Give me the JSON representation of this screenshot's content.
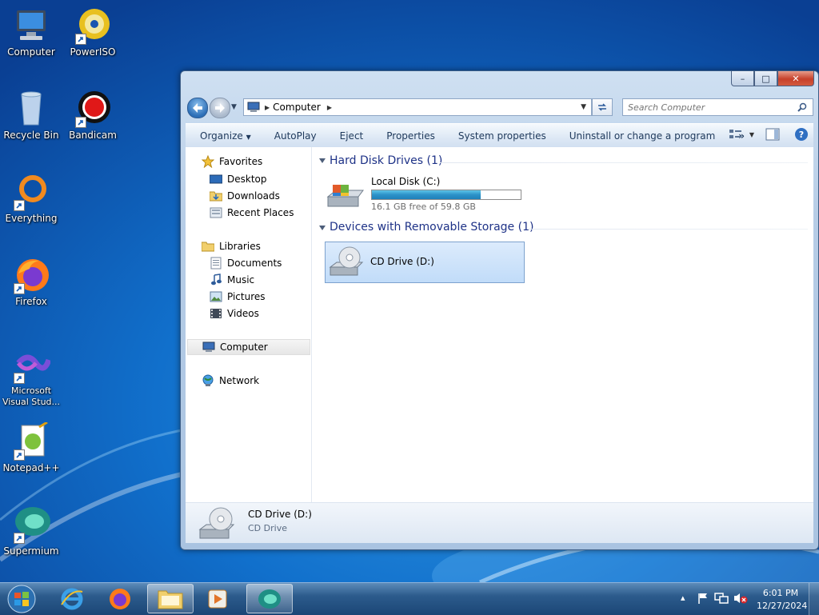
{
  "desktop": {
    "icons": [
      {
        "label": "Computer"
      },
      {
        "label": "PowerISO"
      },
      {
        "label": "Recycle Bin"
      },
      {
        "label": "Bandicam"
      },
      {
        "label": "Everything"
      },
      {
        "label": "Firefox"
      },
      {
        "label": "Microsoft Visual Stud..."
      },
      {
        "label": "Notepad++"
      },
      {
        "label": "Supermium"
      }
    ]
  },
  "window": {
    "controls": {
      "minimize": "–",
      "maximize": "□",
      "close": "✕"
    },
    "address": {
      "path": "Computer"
    },
    "search": {
      "placeholder": "Search Computer"
    },
    "toolbar": {
      "organize": "Organize",
      "autoplay": "AutoPlay",
      "eject": "Eject",
      "properties": "Properties",
      "system_properties": "System properties",
      "uninstall": "Uninstall or change a program",
      "more": "»"
    },
    "nav_pane": {
      "favorites": "Favorites",
      "desktop": "Desktop",
      "downloads": "Downloads",
      "recent_places": "Recent Places",
      "libraries": "Libraries",
      "documents": "Documents",
      "music": "Music",
      "pictures": "Pictures",
      "videos": "Videos",
      "computer": "Computer",
      "network": "Network"
    },
    "groups": {
      "hard_disk": "Hard Disk Drives (1)",
      "removable": "Devices with Removable Storage (1)"
    },
    "drives": {
      "c": {
        "name": "Local Disk (C:)",
        "free": "16.1 GB free of 59.8 GB",
        "used_fraction": 0.73
      },
      "d": {
        "name": "CD Drive (D:)"
      }
    },
    "details": {
      "title": "CD Drive (D:)",
      "subtitle": "CD Drive"
    }
  },
  "taskbar": {
    "tray_overflow": "▴",
    "time": "6:01 PM",
    "date": "12/27/2024"
  }
}
